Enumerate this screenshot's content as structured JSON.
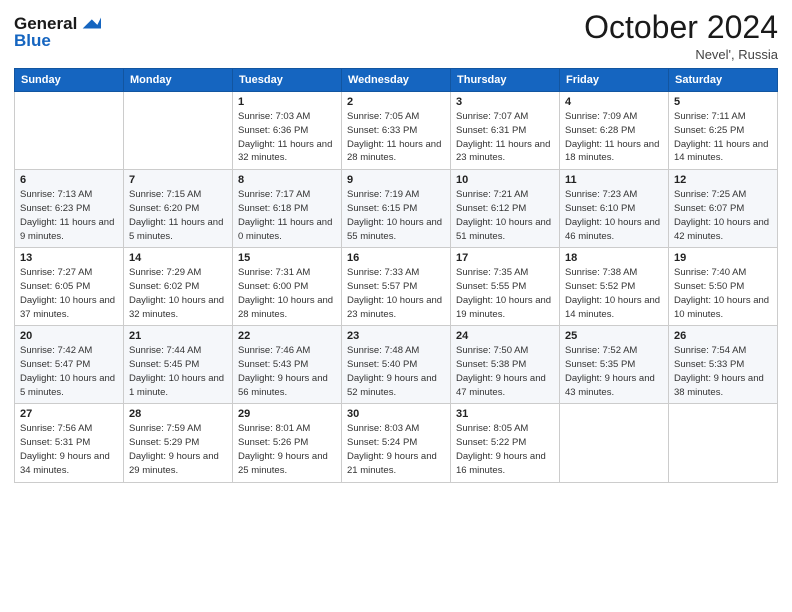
{
  "header": {
    "logo_general": "General",
    "logo_blue": "Blue",
    "month_title": "October 2024",
    "location": "Nevel', Russia"
  },
  "days_of_week": [
    "Sunday",
    "Monday",
    "Tuesday",
    "Wednesday",
    "Thursday",
    "Friday",
    "Saturday"
  ],
  "weeks": [
    [
      null,
      null,
      {
        "day": "1",
        "sunrise": "Sunrise: 7:03 AM",
        "sunset": "Sunset: 6:36 PM",
        "daylight": "Daylight: 11 hours and 32 minutes."
      },
      {
        "day": "2",
        "sunrise": "Sunrise: 7:05 AM",
        "sunset": "Sunset: 6:33 PM",
        "daylight": "Daylight: 11 hours and 28 minutes."
      },
      {
        "day": "3",
        "sunrise": "Sunrise: 7:07 AM",
        "sunset": "Sunset: 6:31 PM",
        "daylight": "Daylight: 11 hours and 23 minutes."
      },
      {
        "day": "4",
        "sunrise": "Sunrise: 7:09 AM",
        "sunset": "Sunset: 6:28 PM",
        "daylight": "Daylight: 11 hours and 18 minutes."
      },
      {
        "day": "5",
        "sunrise": "Sunrise: 7:11 AM",
        "sunset": "Sunset: 6:25 PM",
        "daylight": "Daylight: 11 hours and 14 minutes."
      }
    ],
    [
      {
        "day": "6",
        "sunrise": "Sunrise: 7:13 AM",
        "sunset": "Sunset: 6:23 PM",
        "daylight": "Daylight: 11 hours and 9 minutes."
      },
      {
        "day": "7",
        "sunrise": "Sunrise: 7:15 AM",
        "sunset": "Sunset: 6:20 PM",
        "daylight": "Daylight: 11 hours and 5 minutes."
      },
      {
        "day": "8",
        "sunrise": "Sunrise: 7:17 AM",
        "sunset": "Sunset: 6:18 PM",
        "daylight": "Daylight: 11 hours and 0 minutes."
      },
      {
        "day": "9",
        "sunrise": "Sunrise: 7:19 AM",
        "sunset": "Sunset: 6:15 PM",
        "daylight": "Daylight: 10 hours and 55 minutes."
      },
      {
        "day": "10",
        "sunrise": "Sunrise: 7:21 AM",
        "sunset": "Sunset: 6:12 PM",
        "daylight": "Daylight: 10 hours and 51 minutes."
      },
      {
        "day": "11",
        "sunrise": "Sunrise: 7:23 AM",
        "sunset": "Sunset: 6:10 PM",
        "daylight": "Daylight: 10 hours and 46 minutes."
      },
      {
        "day": "12",
        "sunrise": "Sunrise: 7:25 AM",
        "sunset": "Sunset: 6:07 PM",
        "daylight": "Daylight: 10 hours and 42 minutes."
      }
    ],
    [
      {
        "day": "13",
        "sunrise": "Sunrise: 7:27 AM",
        "sunset": "Sunset: 6:05 PM",
        "daylight": "Daylight: 10 hours and 37 minutes."
      },
      {
        "day": "14",
        "sunrise": "Sunrise: 7:29 AM",
        "sunset": "Sunset: 6:02 PM",
        "daylight": "Daylight: 10 hours and 32 minutes."
      },
      {
        "day": "15",
        "sunrise": "Sunrise: 7:31 AM",
        "sunset": "Sunset: 6:00 PM",
        "daylight": "Daylight: 10 hours and 28 minutes."
      },
      {
        "day": "16",
        "sunrise": "Sunrise: 7:33 AM",
        "sunset": "Sunset: 5:57 PM",
        "daylight": "Daylight: 10 hours and 23 minutes."
      },
      {
        "day": "17",
        "sunrise": "Sunrise: 7:35 AM",
        "sunset": "Sunset: 5:55 PM",
        "daylight": "Daylight: 10 hours and 19 minutes."
      },
      {
        "day": "18",
        "sunrise": "Sunrise: 7:38 AM",
        "sunset": "Sunset: 5:52 PM",
        "daylight": "Daylight: 10 hours and 14 minutes."
      },
      {
        "day": "19",
        "sunrise": "Sunrise: 7:40 AM",
        "sunset": "Sunset: 5:50 PM",
        "daylight": "Daylight: 10 hours and 10 minutes."
      }
    ],
    [
      {
        "day": "20",
        "sunrise": "Sunrise: 7:42 AM",
        "sunset": "Sunset: 5:47 PM",
        "daylight": "Daylight: 10 hours and 5 minutes."
      },
      {
        "day": "21",
        "sunrise": "Sunrise: 7:44 AM",
        "sunset": "Sunset: 5:45 PM",
        "daylight": "Daylight: 10 hours and 1 minute."
      },
      {
        "day": "22",
        "sunrise": "Sunrise: 7:46 AM",
        "sunset": "Sunset: 5:43 PM",
        "daylight": "Daylight: 9 hours and 56 minutes."
      },
      {
        "day": "23",
        "sunrise": "Sunrise: 7:48 AM",
        "sunset": "Sunset: 5:40 PM",
        "daylight": "Daylight: 9 hours and 52 minutes."
      },
      {
        "day": "24",
        "sunrise": "Sunrise: 7:50 AM",
        "sunset": "Sunset: 5:38 PM",
        "daylight": "Daylight: 9 hours and 47 minutes."
      },
      {
        "day": "25",
        "sunrise": "Sunrise: 7:52 AM",
        "sunset": "Sunset: 5:35 PM",
        "daylight": "Daylight: 9 hours and 43 minutes."
      },
      {
        "day": "26",
        "sunrise": "Sunrise: 7:54 AM",
        "sunset": "Sunset: 5:33 PM",
        "daylight": "Daylight: 9 hours and 38 minutes."
      }
    ],
    [
      {
        "day": "27",
        "sunrise": "Sunrise: 7:56 AM",
        "sunset": "Sunset: 5:31 PM",
        "daylight": "Daylight: 9 hours and 34 minutes."
      },
      {
        "day": "28",
        "sunrise": "Sunrise: 7:59 AM",
        "sunset": "Sunset: 5:29 PM",
        "daylight": "Daylight: 9 hours and 29 minutes."
      },
      {
        "day": "29",
        "sunrise": "Sunrise: 8:01 AM",
        "sunset": "Sunset: 5:26 PM",
        "daylight": "Daylight: 9 hours and 25 minutes."
      },
      {
        "day": "30",
        "sunrise": "Sunrise: 8:03 AM",
        "sunset": "Sunset: 5:24 PM",
        "daylight": "Daylight: 9 hours and 21 minutes."
      },
      {
        "day": "31",
        "sunrise": "Sunrise: 8:05 AM",
        "sunset": "Sunset: 5:22 PM",
        "daylight": "Daylight: 9 hours and 16 minutes."
      },
      null,
      null
    ]
  ]
}
